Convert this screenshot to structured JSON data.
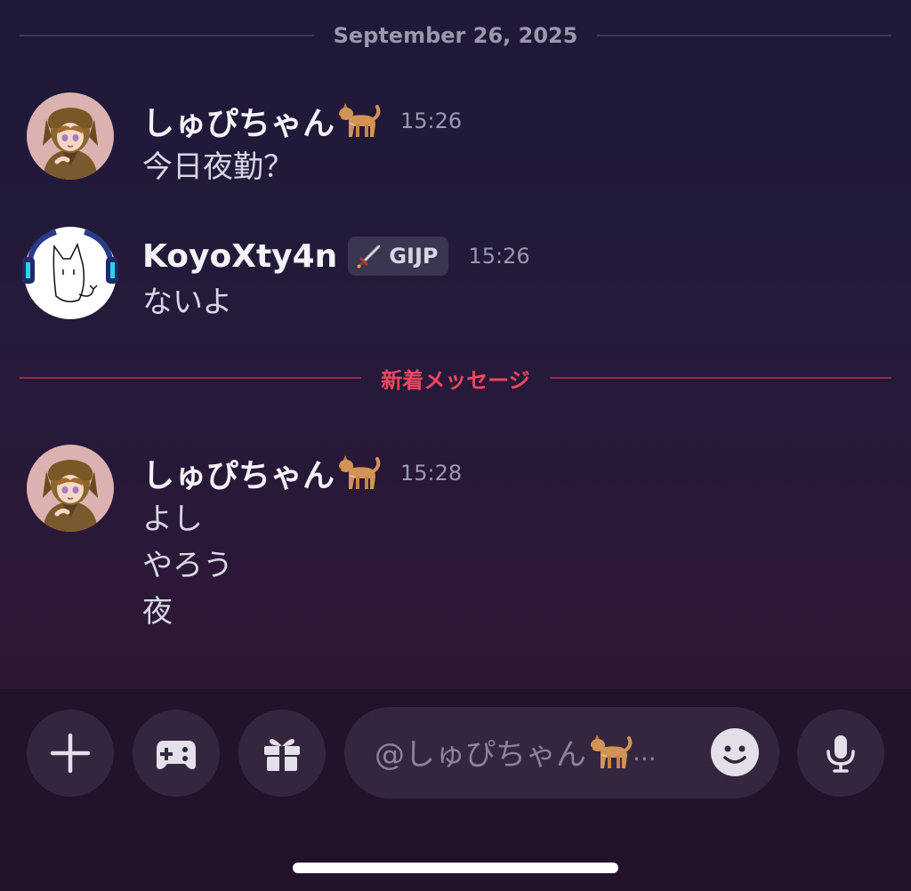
{
  "date_divider": "September 26, 2025",
  "new_messages_divider": "新着メッセージ",
  "messages": [
    {
      "username": "しゅぴちゃん",
      "username_emoji": "dog-emoji",
      "time": "15:26",
      "lines": [
        "今日夜勤？"
      ]
    },
    {
      "username": "KoyoXty4n",
      "tag": "GIJP",
      "tag_icon": "sword-icon",
      "time": "15:26",
      "lines": [
        "ないよ"
      ]
    },
    {
      "username": "しゅぴちゃん",
      "username_emoji": "dog-emoji",
      "time": "15:28",
      "lines": [
        "よし",
        "やろう",
        "夜"
      ]
    }
  ],
  "composer": {
    "placeholder": "@しゅぴちゃん",
    "placeholder_suffix": "...",
    "buttons": [
      "plus-icon",
      "gamepad-icon",
      "gift-icon",
      "emoji-icon",
      "microphone-icon"
    ]
  },
  "colors": {
    "accent_new": "#f0485c",
    "background": "#231a3a"
  }
}
